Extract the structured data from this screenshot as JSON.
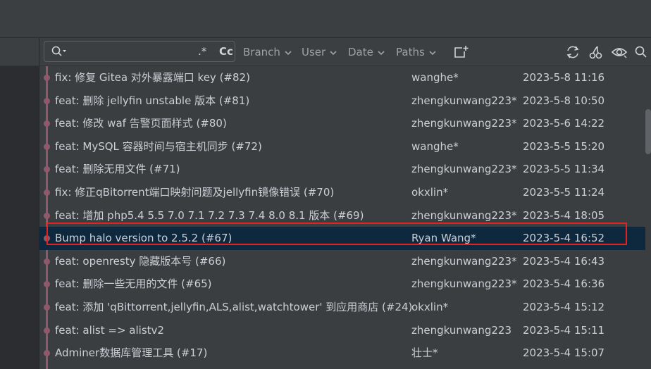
{
  "toolbar": {
    "regex_label": ".*",
    "case_label": "Cc",
    "filters": {
      "branch": "Branch",
      "user": "User",
      "date": "Date",
      "paths": "Paths"
    }
  },
  "commits": [
    {
      "message": "fix: 修复 Gitea 对外暴露端口 key (#82)",
      "author": "wanghe*",
      "date": "2023-5-8 11:16"
    },
    {
      "message": "feat: 删除 jellyfin unstable 版本 (#81)",
      "author": "zhengkunwang223*",
      "date": "2023-5-8 10:50"
    },
    {
      "message": "feat: 修改 waf 告警页面样式 (#80)",
      "author": "zhengkunwang223*",
      "date": "2023-5-6 14:22"
    },
    {
      "message": "feat: MySQL 容器时间与宿主机同步 (#72)",
      "author": "wanghe*",
      "date": "2023-5-5 15:20"
    },
    {
      "message": "feat: 删除无用文件 (#71)",
      "author": "zhengkunwang223*",
      "date": "2023-5-5 11:34"
    },
    {
      "message": "fix: 修正qBitorrent端口映射问题及jellyfin镜像错误 (#70)",
      "author": "okxlin*",
      "date": "2023-5-5 11:24"
    },
    {
      "message": "feat: 增加 php5.4 5.5 7.0 7.1 7.2 7.3 7.4 8.0 8.1 版本 (#69)",
      "author": "zhengkunwang223*",
      "date": "2023-5-4 18:05"
    },
    {
      "message": "Bump halo version to 2.5.2 (#67)",
      "author": "Ryan Wang*",
      "date": "2023-5-4 16:52"
    },
    {
      "message": "feat: openresty 隐藏版本号 (#66)",
      "author": "zhengkunwang223*",
      "date": "2023-5-4 16:43"
    },
    {
      "message": "feat: 删除一些无用的文件 (#65)",
      "author": "zhengkunwang223*",
      "date": "2023-5-4 16:36"
    },
    {
      "message": "feat: 添加 'qBittorrent,jellyfin,ALS,alist,watchtower' 到应用商店 (#24)",
      "author": "okxlin*",
      "date": "2023-5-4 15:12"
    },
    {
      "message": "feat: alist => alistv2",
      "author": "zhengkunwang223",
      "date": "2023-5-4 15:11"
    },
    {
      "message": "Adminer数据库管理工具 (#17)",
      "author": "壮士*",
      "date": "2023-5-4 15:07"
    }
  ],
  "selected_index": 7,
  "colors": {
    "graph": "#8e5a6b",
    "selected_row": "#0e293d",
    "highlight_box": "#e02424"
  }
}
